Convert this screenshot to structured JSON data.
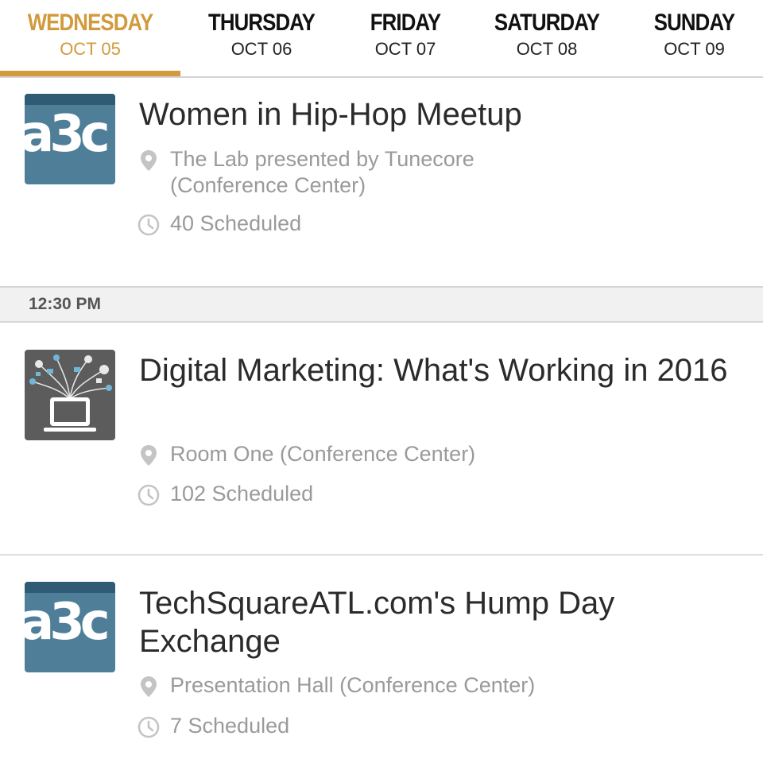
{
  "tabs": [
    {
      "day": "WEDNESDAY",
      "date": "OCT 05",
      "active": true
    },
    {
      "day": "THURSDAY",
      "date": "OCT 06"
    },
    {
      "day": "FRIDAY",
      "date": "OCT 07"
    },
    {
      "day": "SATURDAY",
      "date": "OCT 08"
    },
    {
      "day": "SUNDAY",
      "date": "OCT 09"
    }
  ],
  "colors": {
    "accent": "#d19a3c",
    "logo_blue": "#4f7e99",
    "logo_gray": "#5c5c5c"
  },
  "sessions": [
    {
      "title": "Women in Hip-Hop Meetup",
      "location": "The Lab presented by Tunecore (Conference Center)",
      "scheduled": "40 Scheduled",
      "logo": "a3c-logo"
    },
    {
      "title": "Digital Marketing: What's Working in 2016",
      "location": "Room One (Conference Center)",
      "scheduled": "102 Scheduled",
      "logo": "digital-marketing-icon"
    },
    {
      "title": "TechSquareATL.com's Hump Day Exchange",
      "location": "Presentation Hall (Conference Center)",
      "scheduled": "7 Scheduled",
      "logo": "a3c-logo"
    }
  ],
  "time_header": "12:30 PM"
}
